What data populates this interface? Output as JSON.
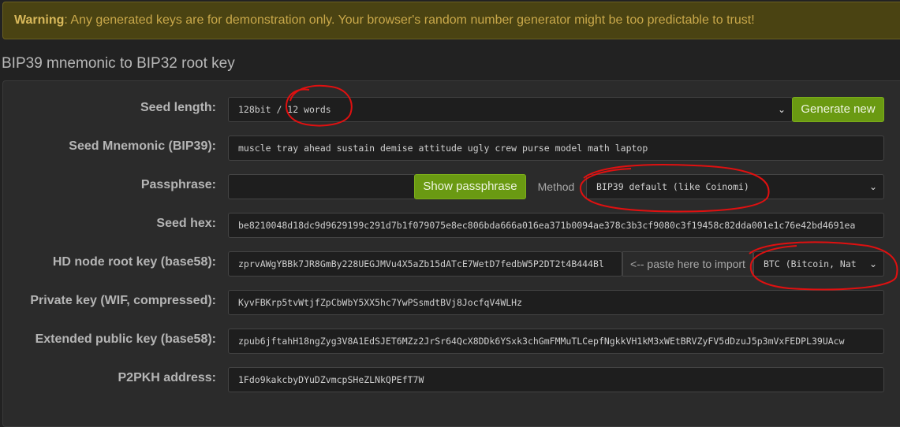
{
  "warning": {
    "label": "Warning",
    "text": ": Any generated keys are for demonstration only. Your browser's random number generator might be too predictable to trust!"
  },
  "section_title": "BIP39 mnemonic to BIP32 root key",
  "seed_length": {
    "label": "Seed length:",
    "value": "128bit / 12 words",
    "generate_button": "Generate new"
  },
  "mnemonic": {
    "label": "Seed Mnemonic (BIP39):",
    "value": "muscle tray ahead sustain demise attitude ugly crew purse model math laptop"
  },
  "passphrase": {
    "label": "Passphrase:",
    "value": "",
    "show_button": "Show passphrase",
    "method_label": "Method",
    "method_value": "BIP39 default (like Coinomi)"
  },
  "seed_hex": {
    "label": "Seed hex:",
    "value": "be8210048d18dc9d9629199c291d7b1f079075e8ec806bda666a016ea371b0094ae378c3b3cf9080c3f19458c82dda001e1c76e42bd4691ea"
  },
  "root_key": {
    "label": "HD node root key (base58):",
    "value": "zprvAWgYBBk7JR8GmBy228UEGJMVu4X5aZb15dATcE7WetD7fedbW5P2DT2t4B444Bl",
    "paste_hint": "<-- paste here to import",
    "network_value": "BTC (Bitcoin, Nat"
  },
  "private_key": {
    "label": "Private key (WIF, compressed):",
    "value": "KyvFBKrp5tvWtjfZpCbWbY5XX5hc7YwPSsmdtBVj8JocfqV4WLHz"
  },
  "ext_pub_key": {
    "label": "Extended public key (base58):",
    "value": "zpub6jftahH18ngZyg3V8A1EdSJET6MZz2JrSr64QcX8DDk6YSxk3chGmFMMuTLCepfNgkkVH1kM3xWEtBRVZyFV5dDzuJ5p3mVxFEDPL39UAcw"
  },
  "p2pkh": {
    "label": "P2PKH address:",
    "value": "1Fdo9kakcbyDYuDZvmcpSHeZLNkQPEfT7W"
  },
  "colors": {
    "accent_green": "#6a9a12",
    "annotation_red": "#e01010"
  }
}
